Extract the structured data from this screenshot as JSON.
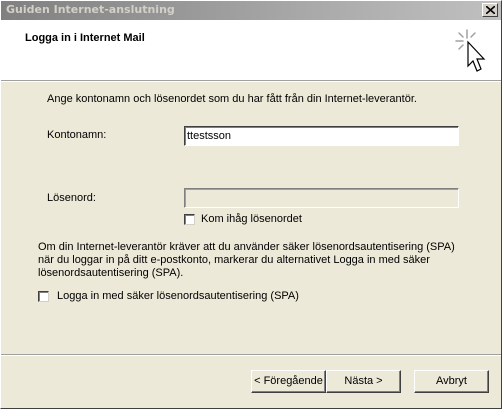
{
  "window": {
    "title": "Guiden Internet-anslutning",
    "close_symbol": "×"
  },
  "header": {
    "title": "Logga in i Internet Mail",
    "icon": "wizard-sparkle-cursor-icon"
  },
  "form": {
    "intro": "Ange kontonamn och lösenordet som du har fått från din Internet-leverantör.",
    "account_label": "Kontonamn:",
    "account_value": "ttestsson",
    "password_label": "Lösenord:",
    "password_value": "",
    "remember_label": "Kom ihåg lösenordet",
    "remember_checked": false,
    "spa_text": [
      "Om din Internet-leverantör kräver att du använder säker lösenordsautentisering (SPA)",
      "när du loggar in på ditt e-postkonto, markerar du alternativet Logga in med säker",
      "lösenordsautentisering (SPA)."
    ],
    "spa_label": "Logga in med säker lösenordsautentisering (SPA)",
    "spa_checked": false
  },
  "buttons": {
    "back": "< Föregående",
    "next": "Nästa >",
    "cancel": "Avbryt"
  },
  "colors": {
    "dialog_bg": "#ECE9D8",
    "titlebar_inactive": "#808080",
    "header_bg": "#ffffff"
  }
}
